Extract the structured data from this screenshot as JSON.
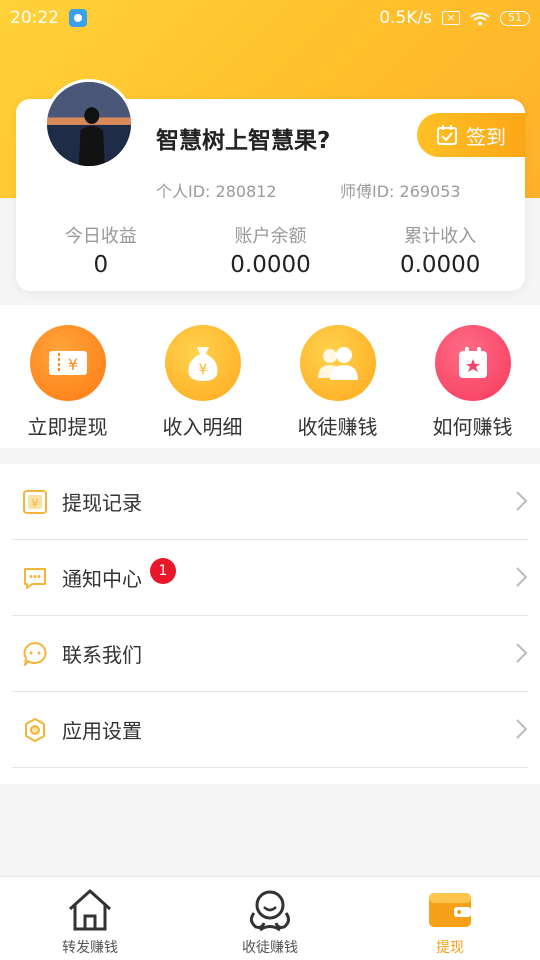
{
  "status_bar": {
    "time": "20:22",
    "network_speed": "0.5K/s",
    "battery": "51"
  },
  "profile": {
    "nickname": "智慧树上智慧果?",
    "checkin_label": "签到",
    "personal_id": "个人ID: 280812",
    "master_id": "师傅ID: 269053"
  },
  "stats": [
    {
      "label": "今日收益",
      "value": "0"
    },
    {
      "label": "账户余额",
      "value": "0.0000"
    },
    {
      "label": "累计收入",
      "value": "0.0000"
    }
  ],
  "quick_actions": [
    {
      "label": "立即提现",
      "icon": "ticket-yen-icon",
      "color": "#ff8a1f"
    },
    {
      "label": "收入明细",
      "icon": "money-bag-icon",
      "color": "#ffb62a"
    },
    {
      "label": "收徒赚钱",
      "icon": "users-icon",
      "color": "#ffb62a"
    },
    {
      "label": "如何赚钱",
      "icon": "calendar-star-icon",
      "color": "#f7456a"
    }
  ],
  "menu": [
    {
      "label": "提现记录",
      "icon": "withdraw-record-icon"
    },
    {
      "label": "通知中心",
      "icon": "notification-icon",
      "badge": "1"
    },
    {
      "label": "联系我们",
      "icon": "chat-icon"
    },
    {
      "label": "应用设置",
      "icon": "settings-icon"
    }
  ],
  "tabbar": [
    {
      "label": "转发赚钱",
      "icon": "home-icon"
    },
    {
      "label": "收徒赚钱",
      "icon": "people-icon"
    },
    {
      "label": "提现",
      "icon": "wallet-icon",
      "active": true
    }
  ],
  "colors": {
    "accent": "#ffb62a",
    "badge": "#e8182a"
  }
}
